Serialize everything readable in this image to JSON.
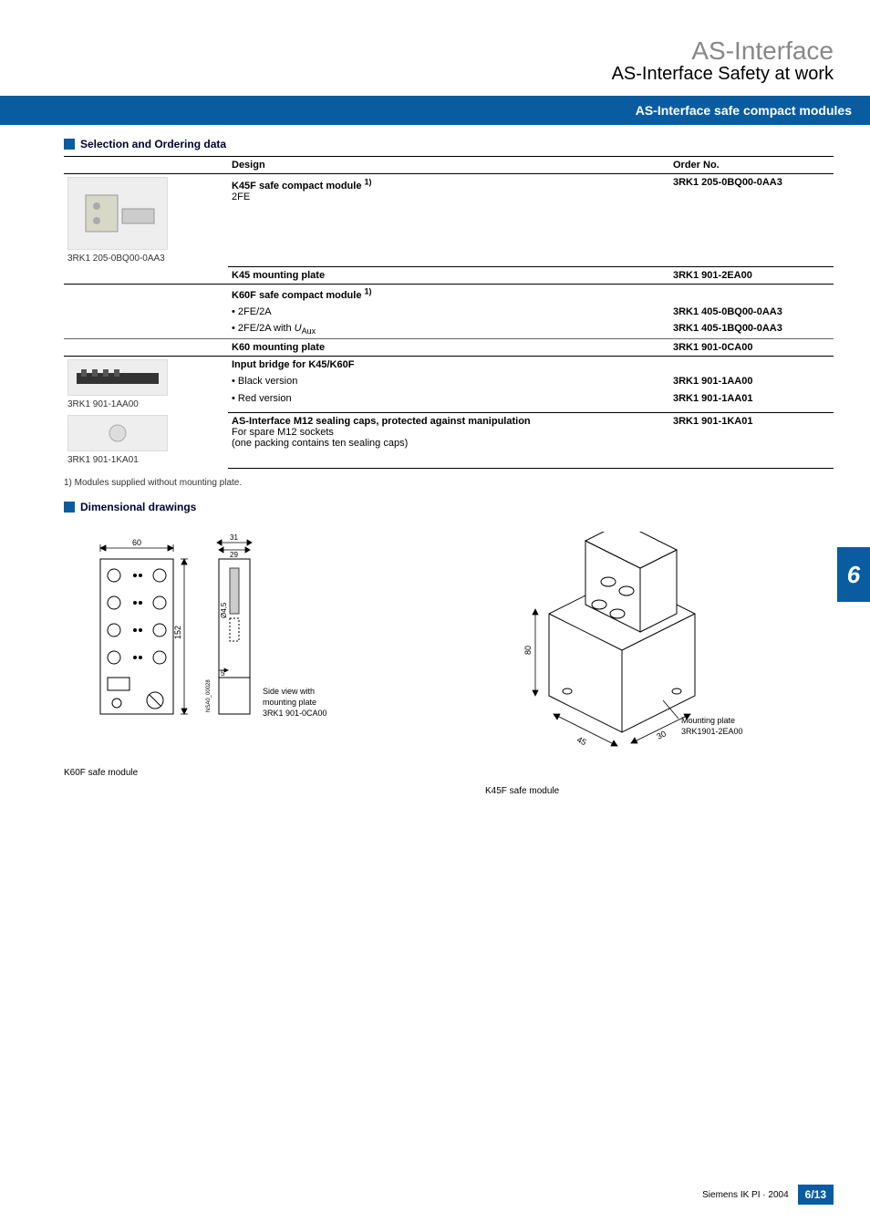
{
  "header": {
    "title_main": "AS-Interface",
    "title_sub": "AS-Interface Safety at work",
    "bar_text": "AS-Interface safe compact modules"
  },
  "sections": {
    "ordering": "Selection and Ordering data",
    "drawings": "Dimensional drawings"
  },
  "table": {
    "head_design": "Design",
    "head_order": "Order No.",
    "rows": {
      "r1_title": "K45F safe compact module ",
      "r1_sup": "1)",
      "r1_sub": "2FE",
      "r1_order": "3RK1 205-0BQ00-0AA3",
      "r1_caption": "3RK1 205-0BQ00-0AA3",
      "r2_title": "K45 mounting plate",
      "r2_order": "3RK1 901-2EA00",
      "r3_title": "K60F safe compact module ",
      "r3_sup": "1)",
      "r3_b1": "• 2FE/2A",
      "r3_b1_order": "3RK1 405-0BQ00-0AA3",
      "r3_b2_pre": "• 2FE/2A with ",
      "r3_b2_u": "U",
      "r3_b2_aux": "Aux",
      "r3_b2_order": "3RK1 405-1BQ00-0AA3",
      "r4_title": "K60 mounting plate",
      "r4_order": "3RK1 901-0CA00",
      "r5_title": "Input bridge for K45/K60F",
      "r5_b1": "• Black version",
      "r5_b1_order": "3RK1 901-1AA00",
      "r5_b2": "• Red version",
      "r5_b2_order": "3RK1 901-1AA01",
      "r5_caption": "3RK1 901-1AA00",
      "r6_title": "AS-Interface M12 sealing caps, protected against manipulation",
      "r6_l2": "For spare M12 sockets",
      "r6_l3": "(one packing contains ten sealing caps)",
      "r6_order": "3RK1 901-1KA01",
      "r6_caption": "3RK1 901-1KA01"
    }
  },
  "footnote": "1) Modules supplied without mounting plate.",
  "drawings": {
    "left_caption": "K60F safe module",
    "left_side_text1": "Side view with",
    "left_side_text2": "mounting plate",
    "left_side_text3": "3RK1 901-0CA00",
    "left_dim_60": "60",
    "left_dim_152": "152",
    "left_dim_31": "31",
    "left_dim_29": "29",
    "left_dim_5": "5",
    "left_dim_d": "Ø4,5",
    "left_code": "NSA0_00028",
    "right_caption": "K45F safe module",
    "right_text1": "Mounting plate",
    "right_text2": "3RK1901-2EA00",
    "right_dim_80": "80",
    "right_dim_45": "45",
    "right_dim_30": "30"
  },
  "side_tab": "6",
  "footer": {
    "text": "Siemens IK PI · 2004",
    "page": "6/13"
  }
}
